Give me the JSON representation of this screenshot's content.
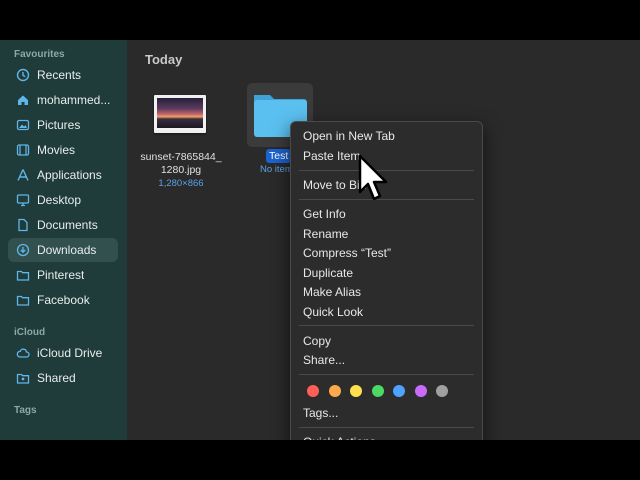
{
  "sidebar": {
    "favourites_header": "Favourites",
    "favourites": [
      {
        "label": "Recents",
        "icon": "clock-icon"
      },
      {
        "label": "mohammed...",
        "icon": "home-icon"
      },
      {
        "label": "Pictures",
        "icon": "photo-icon"
      },
      {
        "label": "Movies",
        "icon": "film-icon"
      },
      {
        "label": "Applications",
        "icon": "applications-icon"
      },
      {
        "label": "Desktop",
        "icon": "desktop-icon"
      },
      {
        "label": "Documents",
        "icon": "document-icon"
      },
      {
        "label": "Downloads",
        "icon": "download-icon",
        "active": true
      },
      {
        "label": "Pinterest",
        "icon": "folder-icon"
      },
      {
        "label": "Facebook",
        "icon": "folder-icon"
      }
    ],
    "icloud_header": "iCloud",
    "icloud": [
      {
        "label": "iCloud Drive",
        "icon": "cloud-icon"
      },
      {
        "label": "Shared",
        "icon": "shared-folder-icon"
      }
    ],
    "tags_header": "Tags"
  },
  "main": {
    "section_title": "Today",
    "files": [
      {
        "name_line1": "sunset-7865844_",
        "name_line2": "1280.jpg",
        "meta": "1,280×866",
        "icon": "image-thumbnail"
      },
      {
        "name": "Test",
        "meta": "No items",
        "icon": "folder-icon",
        "selected": true
      }
    ]
  },
  "context_menu": {
    "group1": [
      "Open in New Tab",
      "Paste Item"
    ],
    "group2": [
      "Move to Bin"
    ],
    "group3": [
      "Get Info",
      "Rename",
      "Compress “Test”",
      "Duplicate",
      "Make Alias",
      "Quick Look"
    ],
    "group4": [
      "Copy",
      "Share..."
    ],
    "tag_colors": [
      "#ff5f57",
      "#ffa94d",
      "#ffe14d",
      "#4cd964",
      "#4da3ff",
      "#c86bfa",
      "#a0a0a0"
    ],
    "tags_label": "Tags...",
    "cut_off_item": "Quick Actions"
  },
  "colors": {
    "sidebar_bg": "#1f3b3a",
    "sidebar_accent": "#5fb6e8",
    "selection_blue": "#1b63d1",
    "folder_blue": "#5ac0f0"
  }
}
